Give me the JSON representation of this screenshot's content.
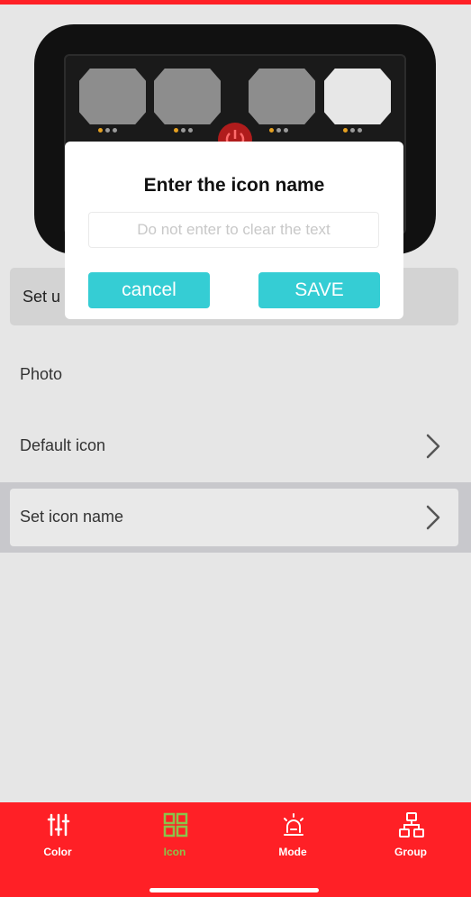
{
  "colors": {
    "tab_bar": "#ff2026",
    "accent_button": "#35cdd4",
    "active_tab": "#8bc34a",
    "indicator_dot": "#e5a021"
  },
  "set_row": {
    "label": "Set u"
  },
  "list": {
    "photo_label": "Photo",
    "default_icon_label": "Default icon",
    "set_icon_name_label": "Set icon name"
  },
  "dialog": {
    "title": "Enter the icon name",
    "input_value": "",
    "input_placeholder": "Do not enter to clear the text",
    "cancel_label": "cancel",
    "save_label": "SAVE"
  },
  "tabs": [
    {
      "label": "Color",
      "icon": "sliders-icon",
      "active": false
    },
    {
      "label": "Icon",
      "icon": "grid-icon",
      "active": true
    },
    {
      "label": "Mode",
      "icon": "alarm-light-icon",
      "active": false
    },
    {
      "label": "Group",
      "icon": "group-hierarchy-icon",
      "active": false
    }
  ]
}
